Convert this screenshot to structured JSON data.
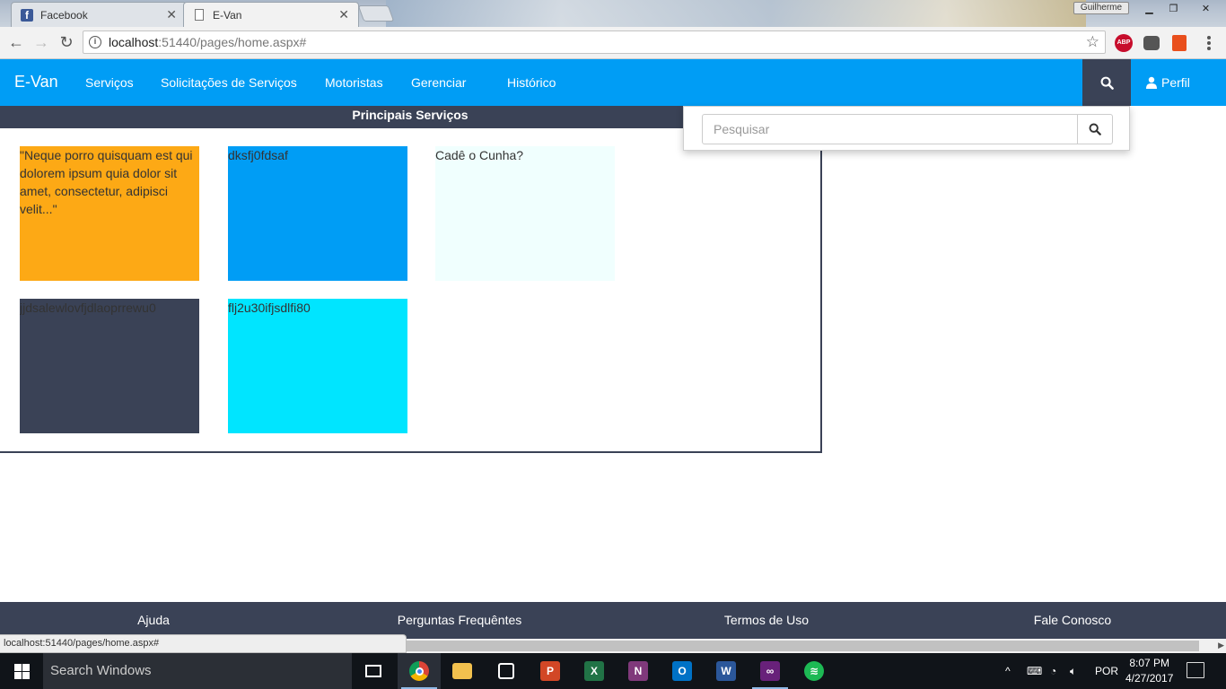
{
  "browser": {
    "tabs": [
      {
        "title": "Facebook",
        "icon": "facebook-icon"
      },
      {
        "title": "E-Van",
        "icon": "page-icon"
      }
    ],
    "window_user": "Guilherme",
    "address": {
      "host": "localhost",
      "path": ":51440/pages/home.aspx#"
    },
    "status_url": "localhost:51440/pages/home.aspx#"
  },
  "navbar": {
    "brand": "E-Van",
    "links": [
      "Serviços",
      "Solicitações de Serviços",
      "Motoristas",
      "Gerenciar",
      "Histórico"
    ],
    "profile_label": "Perfil",
    "color": "#009df5",
    "dark": "#3a4256"
  },
  "search": {
    "placeholder": "Pesquisar"
  },
  "services": {
    "title": "Principais Serviços",
    "cards": [
      {
        "text": "\"Neque porro quisquam est qui dolorem ipsum quia dolor sit amet, consectetur, adipisci velit...\"",
        "color": "#fda915"
      },
      {
        "text": "dksfj0fdsaf",
        "color": "#009df5"
      },
      {
        "text": "Cadê o Cunha?",
        "color": "#f0fffe"
      },
      {
        "text": "jjdsalewlovfjdlaoprrewu0",
        "color": "#3a4256"
      },
      {
        "text": "flj2u30ifjsdlfi80",
        "color": "#00e5ff"
      }
    ]
  },
  "footer": {
    "links": [
      "Ajuda",
      "Perguntas Frequêntes",
      "Termos de Uso",
      "Fale Conosco"
    ]
  },
  "taskbar": {
    "search_placeholder": "Search Windows",
    "language": "POR",
    "time": "8:07 PM",
    "date": "4/27/2017"
  }
}
